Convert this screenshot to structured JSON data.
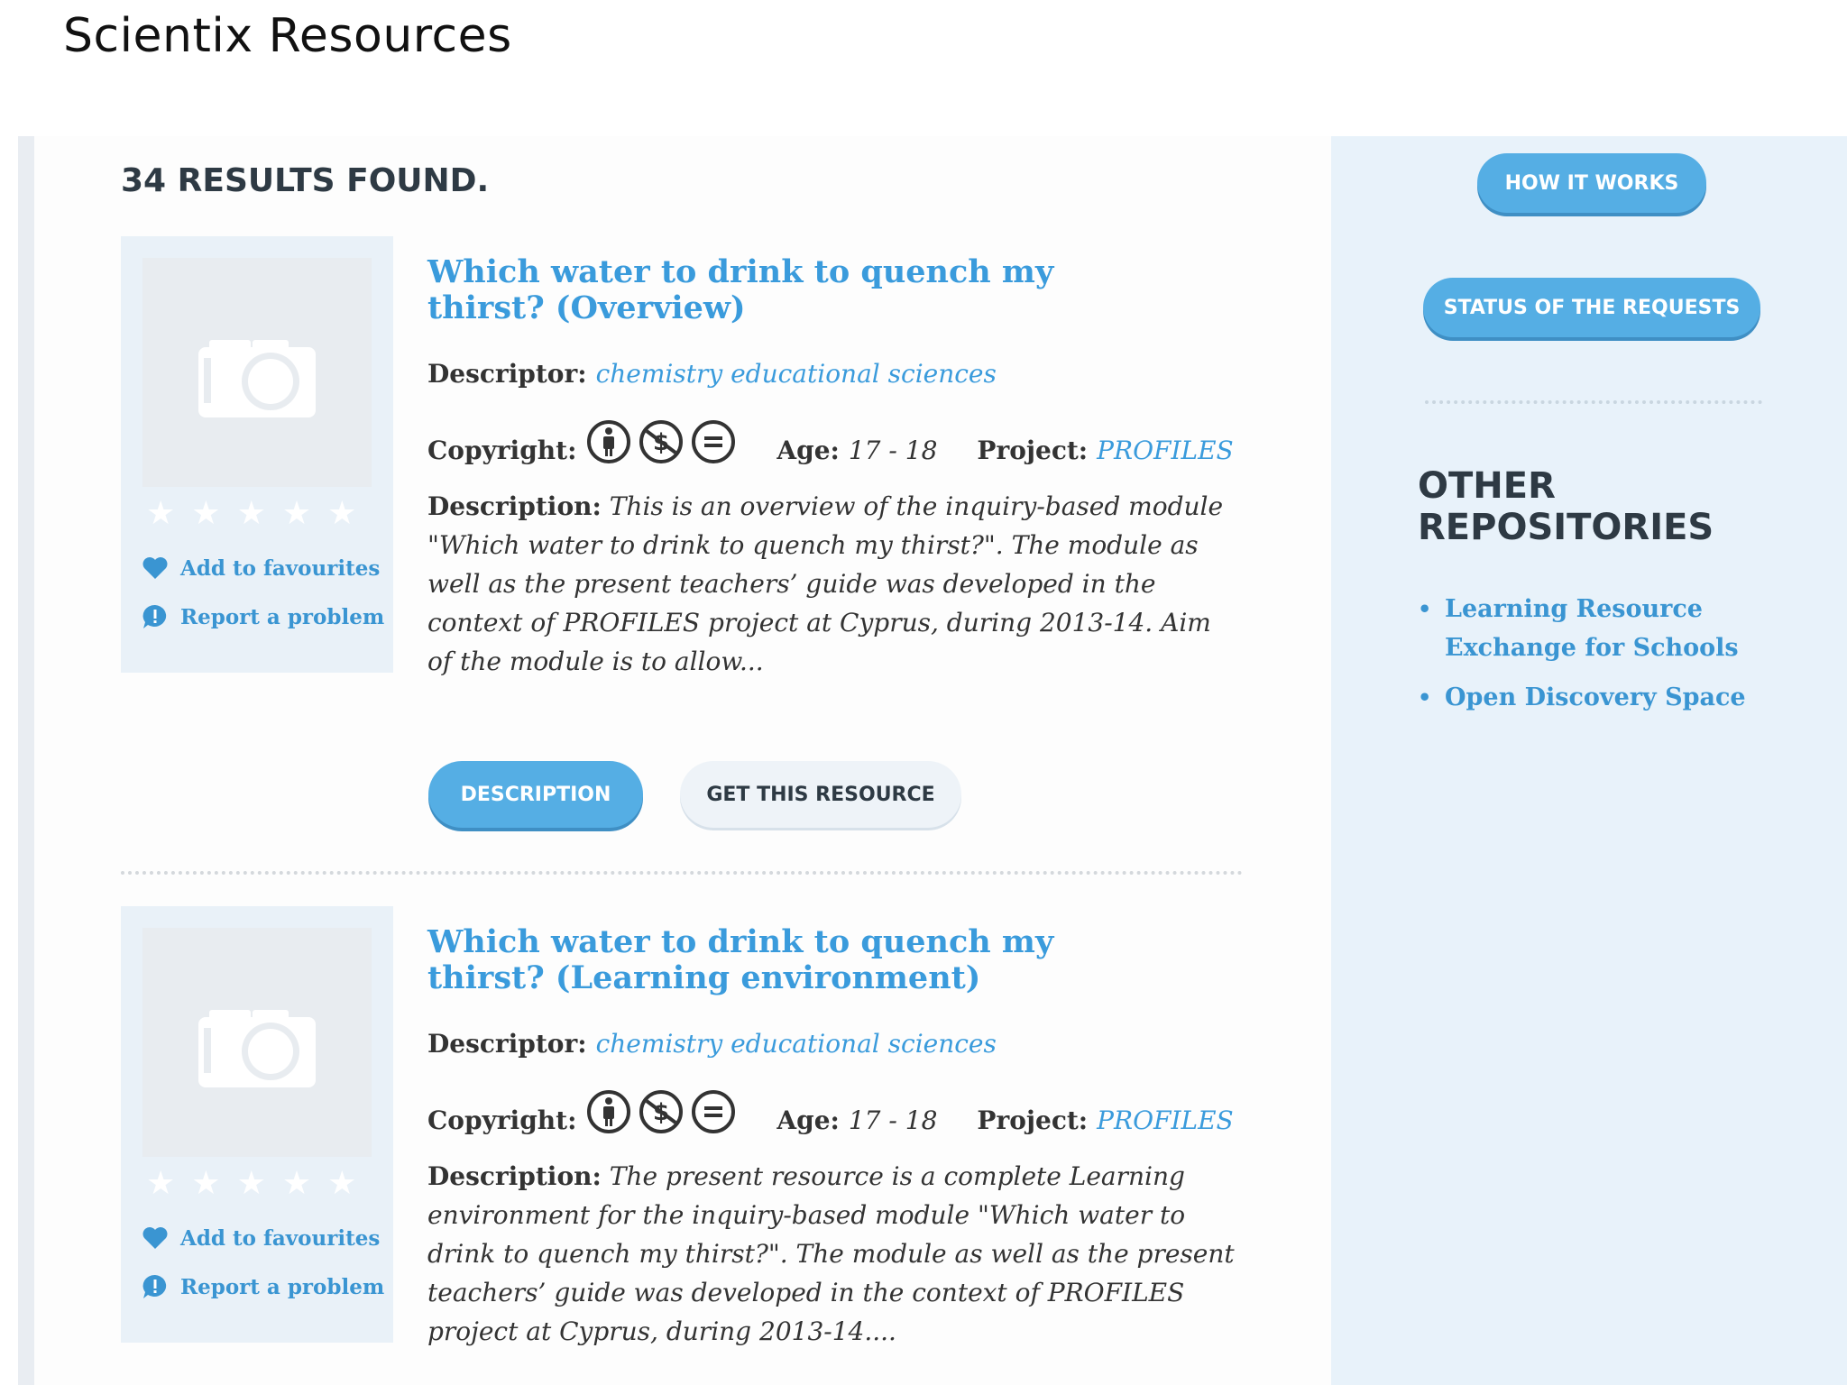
{
  "page_title": "Scientix Resources",
  "results": {
    "count_label": "34 RESULTS FOUND."
  },
  "labels": {
    "descriptor": "Descriptor:",
    "copyright": "Copyright:",
    "age": "Age:",
    "project": "Project:",
    "description": "Description:",
    "add_to_favourites": "Add to favourites",
    "report_problem": "Report a problem",
    "description_button": "DESCRIPTION",
    "get_resource_button": "GET THIS RESOURCE"
  },
  "resources": [
    {
      "title": "Which water to drink to quench my thirst? (Overview)",
      "descriptor": "chemistry educational sciences",
      "age": "17 - 18",
      "project": "PROFILES",
      "description": "This is an overview of the inquiry-based module \"Which water to drink to quench my thirst?\". The module as well as the present teachers’ guide was developed in the context of PROFILES project at Cyprus, during 2013-14. Aim of the module is to allow...",
      "rating": 0,
      "license_icons": [
        "cc-by-icon",
        "cc-nc-icon",
        "cc-nd-icon"
      ]
    },
    {
      "title": "Which water to drink to quench my thirst? (Learning environment)",
      "descriptor": "chemistry educational sciences",
      "age": "17 - 18",
      "project": "PROFILES",
      "description": "The present resource is a complete Learning environment for the inquiry-based module \"Which water to drink to quench my thirst?\". The module as well as the present teachers’ guide was developed in the context of PROFILES project at Cyprus, during 2013-14....",
      "rating": 0,
      "license_icons": [
        "cc-by-icon",
        "cc-nc-icon",
        "cc-nd-icon"
      ]
    }
  ],
  "sidebar": {
    "how_it_works": "HOW IT WORKS",
    "status_requests": "STATUS OF THE REQUESTS",
    "other_repositories_heading": "OTHER REPOSITORIES",
    "repositories": [
      "Learning Resource Exchange for Schools",
      "Open Discovery Space"
    ]
  },
  "colors": {
    "accent": "#3a9bdc",
    "button": "#55aee4",
    "sidebar_bg": "#e8f2fa",
    "heading": "#2e3a44"
  }
}
